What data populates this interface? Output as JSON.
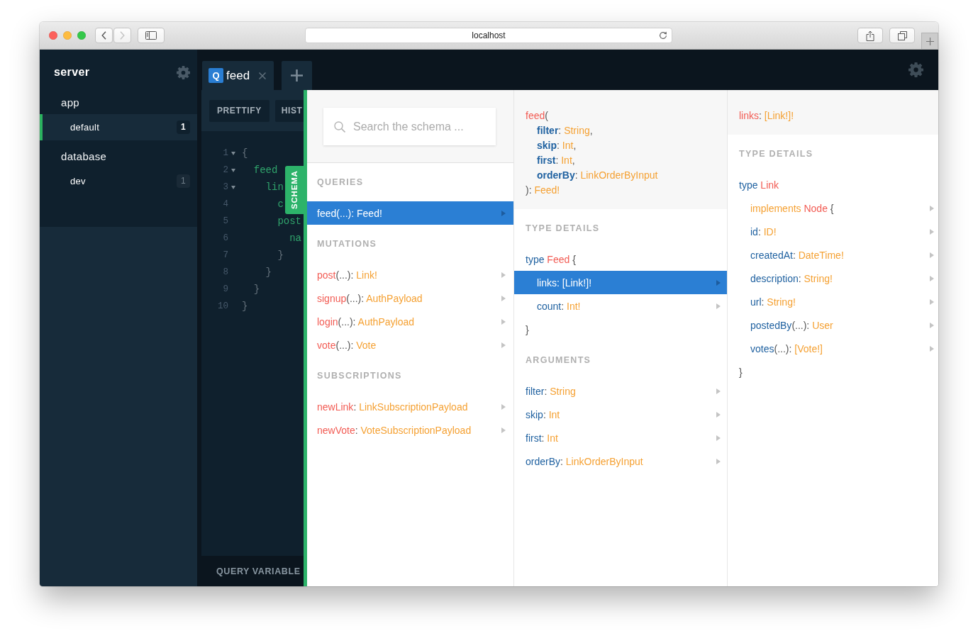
{
  "browser": {
    "address": "localhost",
    "nav": [
      {
        "kind": "back",
        "disabled": false
      },
      {
        "kind": "forward",
        "disabled": true
      }
    ]
  },
  "sidebar": {
    "title": "server",
    "groups": [
      {
        "label": "app",
        "items": [
          {
            "label": "default",
            "count": "1",
            "selected": true
          }
        ]
      },
      {
        "label": "database",
        "items": [
          {
            "label": "dev",
            "count": "1",
            "selected": false
          }
        ]
      }
    ]
  },
  "tabs": [
    {
      "badge": "Q",
      "label": "feed",
      "selected": true
    }
  ],
  "toolbar": {
    "buttons": [
      "PRETTIFY",
      "HIST"
    ]
  },
  "editor": {
    "lines": [
      {
        "number": "1",
        "foldable": true,
        "kind": "punctuation",
        "text": "{",
        "children": [
          {
            "number": "2",
            "foldable": true,
            "kind": "field",
            "text": "feed",
            "children": [
              {
                "number": "3",
                "foldable": true,
                "kind": "field",
                "text": "lin",
                "children": [
                  {
                    "number": "4",
                    "foldable": false,
                    "kind": "field",
                    "text": "c"
                  },
                  {
                    "number": "5",
                    "foldable": false,
                    "kind": "field",
                    "text": "post",
                    "children": [
                      {
                        "number": "6",
                        "foldable": false,
                        "kind": "field",
                        "text": "na"
                      }
                    ]
                  },
                  {
                    "number": "7",
                    "foldable": false,
                    "kind": "punctuation",
                    "text": "}"
                  }
                ]
              },
              {
                "number": "8",
                "foldable": false,
                "kind": "punctuation",
                "text": "}"
              }
            ]
          },
          {
            "number": "9",
            "foldable": false,
            "kind": "punctuation",
            "text": "}"
          }
        ]
      },
      {
        "number": "10",
        "foldable": false,
        "kind": "punctuation",
        "text": "}"
      }
    ]
  },
  "query_variables": {
    "label": "QUERY VARIABLE"
  },
  "schema": {
    "tab": {
      "label": "SCHEMA"
    },
    "columns": [
      {
        "search": {
          "placeholder": "Search the schema ..."
        },
        "sections": [
          {
            "title": "QUERIES",
            "rows": [
              {
                "kind": "field",
                "selected": true,
                "parts": [
                  {
                    "text": "feed",
                    "kind": "name"
                  },
                  {
                    "text": "(...): ",
                    "kind": "punct"
                  },
                  {
                    "text": "Feed!",
                    "kind": "type"
                  }
                ]
              }
            ]
          },
          {
            "title": "MUTATIONS",
            "rows": [
              {
                "kind": "field",
                "selected": false,
                "parts": [
                  {
                    "text": "post",
                    "kind": "name"
                  },
                  {
                    "text": "(...): ",
                    "kind": "punct"
                  },
                  {
                    "text": "Link!",
                    "kind": "type"
                  }
                ]
              },
              {
                "kind": "field",
                "selected": false,
                "parts": [
                  {
                    "text": "signup",
                    "kind": "name"
                  },
                  {
                    "text": "(...): ",
                    "kind": "punct"
                  },
                  {
                    "text": "AuthPayload",
                    "kind": "type"
                  }
                ]
              },
              {
                "kind": "field",
                "selected": false,
                "parts": [
                  {
                    "text": "login",
                    "kind": "name"
                  },
                  {
                    "text": "(...): ",
                    "kind": "punct"
                  },
                  {
                    "text": "AuthPayload",
                    "kind": "type"
                  }
                ]
              },
              {
                "kind": "field",
                "selected": false,
                "parts": [
                  {
                    "text": "vote",
                    "kind": "name"
                  },
                  {
                    "text": "(...): ",
                    "kind": "punct"
                  },
                  {
                    "text": "Vote",
                    "kind": "type"
                  }
                ]
              }
            ]
          },
          {
            "title": "SUBSCRIPTIONS",
            "rows": [
              {
                "kind": "field",
                "selected": false,
                "parts": [
                  {
                    "text": "newLink",
                    "kind": "name"
                  },
                  {
                    "text": ": ",
                    "kind": "punct"
                  },
                  {
                    "text": "LinkSubscriptionPayload",
                    "kind": "type"
                  }
                ]
              },
              {
                "kind": "field",
                "selected": false,
                "parts": [
                  {
                    "text": "newVote",
                    "kind": "name"
                  },
                  {
                    "text": ": ",
                    "kind": "punct"
                  },
                  {
                    "text": "VoteSubscriptionPayload",
                    "kind": "type"
                  }
                ]
              }
            ]
          }
        ]
      },
      {
        "header": [
          {
            "parts": [
              {
                "text": "feed",
                "kind": "name"
              },
              {
                "text": "(",
                "kind": "punct"
              }
            ],
            "children": [
              {
                "parts": [
                  {
                    "text": "filter",
                    "kind": "arg"
                  },
                  {
                    "text": ": ",
                    "kind": "punct"
                  },
                  {
                    "text": "String",
                    "kind": "type"
                  },
                  {
                    "text": ",",
                    "kind": "punct"
                  }
                ]
              },
              {
                "parts": [
                  {
                    "text": "skip",
                    "kind": "arg"
                  },
                  {
                    "text": ": ",
                    "kind": "punct"
                  },
                  {
                    "text": "Int",
                    "kind": "type"
                  },
                  {
                    "text": ",",
                    "kind": "punct"
                  }
                ]
              },
              {
                "parts": [
                  {
                    "text": "first",
                    "kind": "arg"
                  },
                  {
                    "text": ": ",
                    "kind": "punct"
                  },
                  {
                    "text": "Int",
                    "kind": "type"
                  },
                  {
                    "text": ",",
                    "kind": "punct"
                  }
                ]
              },
              {
                "parts": [
                  {
                    "text": "orderBy",
                    "kind": "arg"
                  },
                  {
                    "text": ": ",
                    "kind": "punct"
                  },
                  {
                    "text": "LinkOrderByInput",
                    "kind": "type"
                  }
                ]
              }
            ]
          },
          {
            "parts": [
              {
                "text": "): ",
                "kind": "punct"
              },
              {
                "text": "Feed!",
                "kind": "type"
              }
            ]
          }
        ],
        "sections": [
          {
            "title": "TYPE DETAILS",
            "rows": [
              {
                "kind": "type",
                "parts": [
                  {
                    "text": "type ",
                    "kind": "keyword"
                  },
                  {
                    "text": "Feed",
                    "kind": "name"
                  },
                  {
                    "text": " {",
                    "kind": "punct"
                  }
                ],
                "children": [
                  {
                    "kind": "field",
                    "selected": true,
                    "parts": [
                      {
                        "text": "links",
                        "kind": "field"
                      },
                      {
                        "text": ": ",
                        "kind": "punct"
                      },
                      {
                        "text": "[Link!]!",
                        "kind": "type"
                      }
                    ]
                  },
                  {
                    "kind": "field",
                    "selected": false,
                    "parts": [
                      {
                        "text": "count",
                        "kind": "field"
                      },
                      {
                        "text": ": ",
                        "kind": "punct"
                      },
                      {
                        "text": "Int!",
                        "kind": "type"
                      }
                    ]
                  }
                ]
              },
              {
                "kind": "close",
                "parts": [
                  {
                    "text": "}",
                    "kind": "punct"
                  }
                ]
              }
            ]
          },
          {
            "title": "ARGUMENTS",
            "rows": [
              {
                "kind": "field",
                "selected": false,
                "parts": [
                  {
                    "text": "filter",
                    "kind": "field"
                  },
                  {
                    "text": ": ",
                    "kind": "punct"
                  },
                  {
                    "text": "String",
                    "kind": "type"
                  }
                ]
              },
              {
                "kind": "field",
                "selected": false,
                "parts": [
                  {
                    "text": "skip",
                    "kind": "field"
                  },
                  {
                    "text": ": ",
                    "kind": "punct"
                  },
                  {
                    "text": "Int",
                    "kind": "type"
                  }
                ]
              },
              {
                "kind": "field",
                "selected": false,
                "parts": [
                  {
                    "text": "first",
                    "kind": "field"
                  },
                  {
                    "text": ": ",
                    "kind": "punct"
                  },
                  {
                    "text": "Int",
                    "kind": "type"
                  }
                ]
              },
              {
                "kind": "field",
                "selected": false,
                "parts": [
                  {
                    "text": "orderBy",
                    "kind": "field"
                  },
                  {
                    "text": ": ",
                    "kind": "punct"
                  },
                  {
                    "text": "LinkOrderByInput",
                    "kind": "type"
                  }
                ]
              }
            ]
          }
        ]
      },
      {
        "header": [
          {
            "parts": [
              {
                "text": "links",
                "kind": "name"
              },
              {
                "text": ": ",
                "kind": "punct"
              },
              {
                "text": "[Link!]!",
                "kind": "type"
              }
            ]
          }
        ],
        "sections": [
          {
            "title": "TYPE DETAILS",
            "rows": [
              {
                "kind": "type",
                "parts": [
                  {
                    "text": "type ",
                    "kind": "keyword"
                  },
                  {
                    "text": "Link",
                    "kind": "name"
                  }
                ],
                "children": [
                  {
                    "kind": "field",
                    "selected": false,
                    "parts": [
                      {
                        "text": "implements ",
                        "kind": "implements"
                      },
                      {
                        "text": "Node",
                        "kind": "name"
                      },
                      {
                        "text": " {",
                        "kind": "punct"
                      }
                    ]
                  },
                  {
                    "kind": "field",
                    "selected": false,
                    "parts": [
                      {
                        "text": "id",
                        "kind": "field"
                      },
                      {
                        "text": ": ",
                        "kind": "punct"
                      },
                      {
                        "text": "ID!",
                        "kind": "type"
                      }
                    ]
                  },
                  {
                    "kind": "field",
                    "selected": false,
                    "parts": [
                      {
                        "text": "createdAt",
                        "kind": "field"
                      },
                      {
                        "text": ": ",
                        "kind": "punct"
                      },
                      {
                        "text": "DateTime!",
                        "kind": "type"
                      }
                    ]
                  },
                  {
                    "kind": "field",
                    "selected": false,
                    "parts": [
                      {
                        "text": "description",
                        "kind": "field"
                      },
                      {
                        "text": ": ",
                        "kind": "punct"
                      },
                      {
                        "text": "String!",
                        "kind": "type"
                      }
                    ]
                  },
                  {
                    "kind": "field",
                    "selected": false,
                    "parts": [
                      {
                        "text": "url",
                        "kind": "field"
                      },
                      {
                        "text": ": ",
                        "kind": "punct"
                      },
                      {
                        "text": "String!",
                        "kind": "type"
                      }
                    ]
                  },
                  {
                    "kind": "field",
                    "selected": false,
                    "parts": [
                      {
                        "text": "postedBy",
                        "kind": "field"
                      },
                      {
                        "text": "(...): ",
                        "kind": "punct"
                      },
                      {
                        "text": "User",
                        "kind": "type"
                      }
                    ]
                  },
                  {
                    "kind": "field",
                    "selected": false,
                    "parts": [
                      {
                        "text": "votes",
                        "kind": "field"
                      },
                      {
                        "text": "(...): ",
                        "kind": "punct"
                      },
                      {
                        "text": "[Vote!]",
                        "kind": "type"
                      }
                    ]
                  }
                ]
              },
              {
                "kind": "close",
                "parts": [
                  {
                    "text": "}",
                    "kind": "punct"
                  }
                ]
              }
            ]
          }
        ]
      }
    ]
  }
}
